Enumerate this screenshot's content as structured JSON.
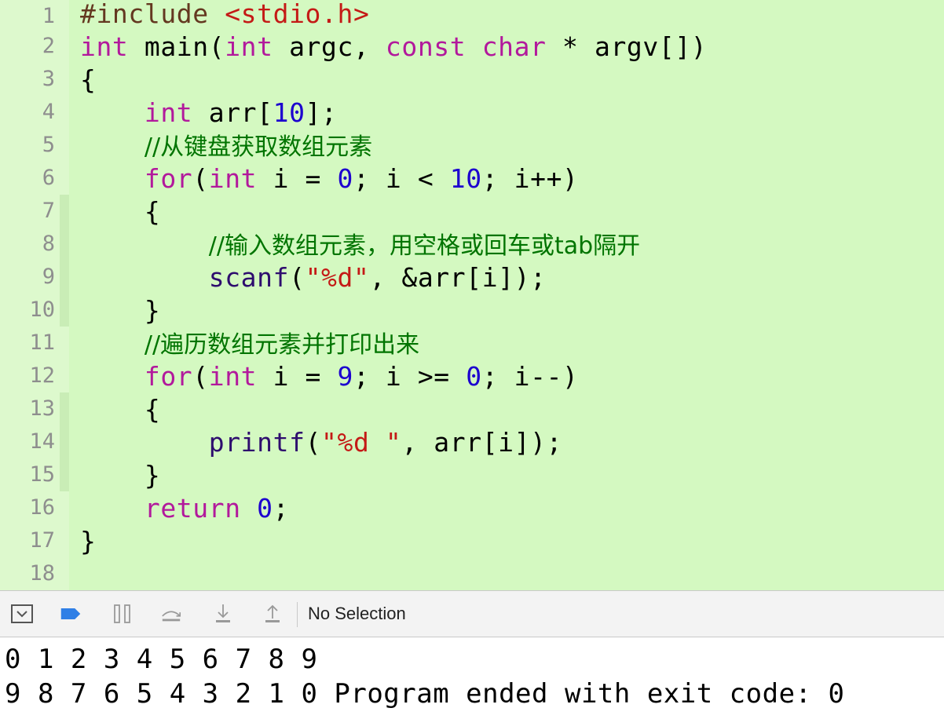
{
  "editor": {
    "line_numbers": [
      "1",
      "2",
      "3",
      "4",
      "5",
      "6",
      "7",
      "8",
      "9",
      "10",
      "11",
      "12",
      "13",
      "14",
      "15",
      "16",
      "17",
      "18"
    ],
    "lines": {
      "l1": {
        "a": "#include ",
        "b": "<stdio.h>"
      },
      "l2": {
        "a": "int",
        "b": " main(",
        "c": "int",
        "d": " argc, ",
        "e": "const",
        "f": " ",
        "g": "char",
        "h": " * argv[])"
      },
      "l3": {
        "a": "{"
      },
      "l4": {
        "a": "    ",
        "b": "int",
        "c": " arr[",
        "d": "10",
        "e": "];"
      },
      "l5": {
        "a": "    ",
        "b": "//从键盘获取数组元素"
      },
      "l6": {
        "a": "    ",
        "b": "for",
        "c": "(",
        "d": "int",
        "e": " i = ",
        "f": "0",
        "g": "; i < ",
        "h": "10",
        "i": "; i++)"
      },
      "l7": {
        "a": "    {"
      },
      "l8": {
        "a": "        ",
        "b": "//输入数组元素，用空格或回车或tab隔开"
      },
      "l9": {
        "a": "        ",
        "b": "scanf",
        "c": "(",
        "d": "\"%d\"",
        "e": ", &arr[i]);"
      },
      "l10": {
        "a": "    }"
      },
      "l11": {
        "a": "    ",
        "b": "//遍历数组元素并打印出来"
      },
      "l12": {
        "a": "    ",
        "b": "for",
        "c": "(",
        "d": "int",
        "e": " i = ",
        "f": "9",
        "g": "; i >= ",
        "h": "0",
        "i": "; i--)"
      },
      "l13": {
        "a": "    {"
      },
      "l14": {
        "a": "        ",
        "b": "printf",
        "c": "(",
        "d": "\"%d \"",
        "e": ", arr[i]);"
      },
      "l15": {
        "a": "    }"
      },
      "l16": {
        "a": "    ",
        "b": "return",
        "c": " ",
        "d": "0",
        "e": ";"
      },
      "l17": {
        "a": "}"
      },
      "l18": {
        "a": ""
      }
    }
  },
  "debug_bar": {
    "icons": [
      "hide-debug-area-icon",
      "breakpoints-toggle-icon",
      "pause-icon",
      "step-over-icon",
      "step-into-icon",
      "step-out-icon"
    ],
    "selection_label": "No Selection",
    "accent_color": "#2f7fe6"
  },
  "console": {
    "line1": "0 1 2 3 4 5 6 7 8 9",
    "line2": "9 8 7 6 5 4 3 2 1 0 Program ended with exit code: 0"
  },
  "colors": {
    "editor_bg": "#d4f9c1",
    "keyword": "#b2199c",
    "string": "#c41a16",
    "number": "#1c00cf",
    "comment": "#007400"
  }
}
